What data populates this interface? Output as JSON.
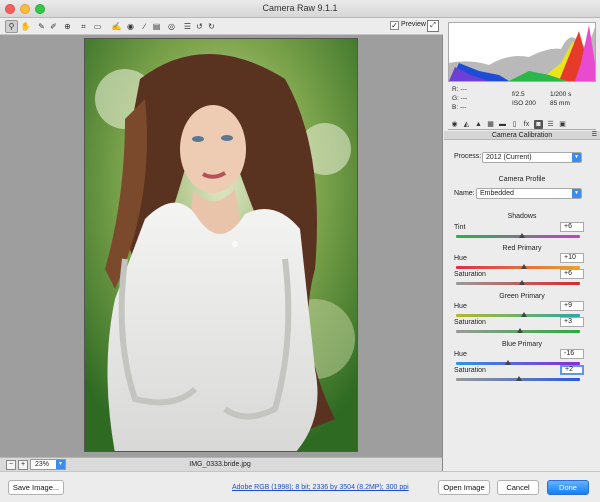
{
  "window": {
    "title": "Camera Raw 9.1.1"
  },
  "toolbar": {
    "tools": [
      {
        "name": "zoom-tool-icon",
        "glyph": "⚲",
        "active": true
      },
      {
        "name": "hand-tool-icon",
        "glyph": "✋",
        "active": false
      },
      {
        "name": "white-balance-tool-icon",
        "glyph": "✎",
        "active": false
      },
      {
        "name": "color-sampler-tool-icon",
        "glyph": "✐",
        "active": false
      },
      {
        "name": "targeted-adjustment-tool-icon",
        "glyph": "⊕",
        "active": false
      },
      {
        "name": "crop-tool-icon",
        "glyph": "⌗",
        "active": false
      },
      {
        "name": "straighten-tool-icon",
        "glyph": "▭",
        "active": false
      },
      {
        "name": "spot-removal-tool-icon",
        "glyph": "✍",
        "active": false
      },
      {
        "name": "red-eye-removal-tool-icon",
        "glyph": "◉",
        "active": false
      },
      {
        "name": "adjustment-brush-icon",
        "glyph": "∕",
        "active": false
      },
      {
        "name": "graduated-filter-icon",
        "glyph": "▤",
        "active": false
      },
      {
        "name": "radial-filter-icon",
        "glyph": "◎",
        "active": false
      },
      {
        "name": "preferences-icon",
        "glyph": "☰",
        "active": false
      },
      {
        "name": "rotate-left-icon",
        "glyph": "↺",
        "active": false
      },
      {
        "name": "rotate-right-icon",
        "glyph": "↻",
        "active": false
      }
    ],
    "preview_label": "Preview",
    "preview_checked": "✓"
  },
  "canvas": {
    "zoom": "23%",
    "filename": "IMG_0333.bride.jpg"
  },
  "readout": {
    "r": "R:  ---",
    "g": "G:  ---",
    "b": "B:  ---",
    "aperture": "f/2.5",
    "shutter": "1/200 s",
    "iso": "ISO 200",
    "focal": "85 mm"
  },
  "panel": {
    "tabs": [
      "basic-tab-icon",
      "tone-curve-tab-icon",
      "detail-tab-icon",
      "hsl-tab-icon",
      "split-toning-tab-icon",
      "lens-corrections-tab-icon",
      "effects-tab-icon",
      "camera-calibration-tab-icon",
      "presets-tab-icon",
      "snapshots-tab-icon"
    ],
    "tab_glyphs": [
      "◉",
      "◭",
      "▲",
      "▦",
      "▬",
      "▯",
      "fx",
      "◙",
      "☰",
      "▣"
    ],
    "active_tab": 7,
    "section_title": "Camera Calibration",
    "process_label": "Process:",
    "process_value": "2012 (Current)",
    "camera_profile_heading": "Camera Profile",
    "name_label": "Name:",
    "name_value": "Embedded",
    "shadows_heading": "Shadows",
    "tint_label": "Tint",
    "tint_value": "+6",
    "red_heading": "Red Primary",
    "red_hue_label": "Hue",
    "red_hue_value": "+10",
    "red_sat_label": "Saturation",
    "red_sat_value": "+6",
    "green_heading": "Green Primary",
    "green_hue_label": "Hue",
    "green_hue_value": "+9",
    "green_sat_label": "Saturation",
    "green_sat_value": "+3",
    "blue_heading": "Blue Primary",
    "blue_hue_label": "Hue",
    "blue_hue_value": "-16",
    "blue_sat_label": "Saturation",
    "blue_sat_value": "+2"
  },
  "sliders": {
    "range": [
      -100,
      100
    ],
    "tint": 6,
    "red_hue": 10,
    "red_sat": 6,
    "green_hue": 9,
    "green_sat": 3,
    "blue_hue": -16,
    "blue_sat": 2
  },
  "bottom": {
    "save_label": "Save Image...",
    "workflow_link": "Adobe RGB (1998); 8 bit; 2336 by 3504 (8.2MP); 300 ppi",
    "open_label": "Open Image",
    "cancel_label": "Cancel",
    "done_label": "Done"
  },
  "colors": {
    "accent": "#3b8cf0",
    "done_button": "#0d81fe",
    "canvas_bg": "#9e9e9e"
  }
}
